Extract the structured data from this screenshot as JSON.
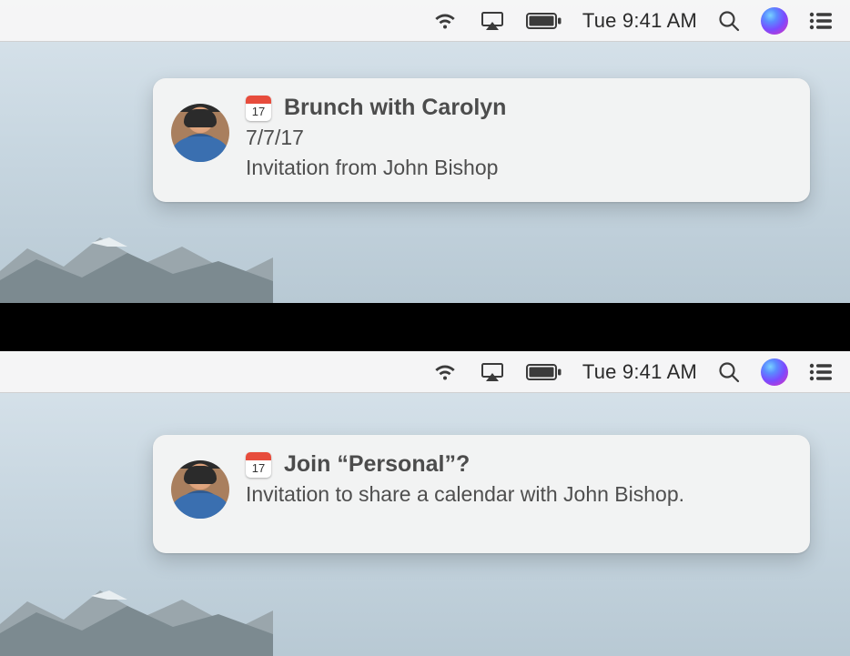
{
  "menubar": {
    "datetime": "Tue 9:41 AM"
  },
  "calendar_icon": {
    "day": "17"
  },
  "notifications": [
    {
      "title": "Brunch with Carolyn",
      "date": "7/7/17",
      "subtitle": "Invitation from John Bishop"
    },
    {
      "title": "Join “Personal”?",
      "subtitle": "Invitation to share a calendar with John Bishop."
    }
  ]
}
